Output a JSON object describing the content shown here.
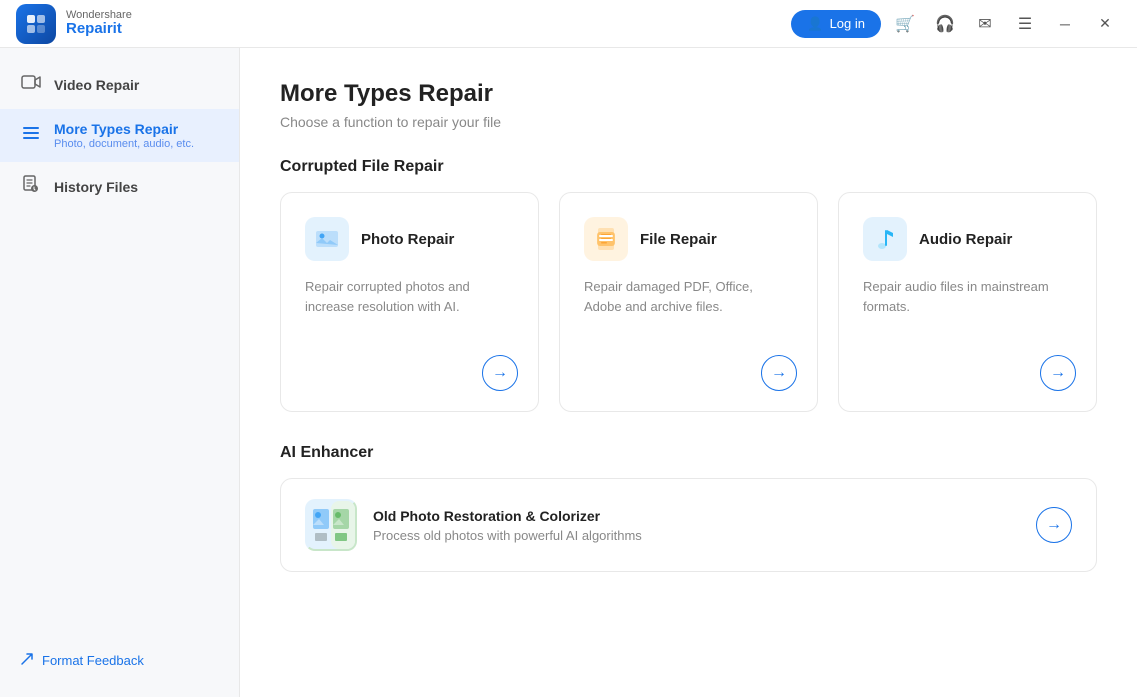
{
  "titlebar": {
    "logo": {
      "brand": "Wondershare",
      "product": "Repairit"
    },
    "login_label": "Log in",
    "icons": {
      "cart": "🛒",
      "headset": "🎧",
      "mail": "✉",
      "menu": "☰",
      "minimize": "─",
      "close": "✕"
    }
  },
  "sidebar": {
    "items": [
      {
        "id": "video-repair",
        "label": "Video Repair",
        "sublabel": "",
        "icon": "🎥",
        "active": false
      },
      {
        "id": "more-types-repair",
        "label": "More Types Repair",
        "sublabel": "Photo, document, audio, etc.",
        "icon": "☰",
        "active": true
      },
      {
        "id": "history-files",
        "label": "History Files",
        "sublabel": "",
        "icon": "☑",
        "active": false
      }
    ],
    "footer": {
      "feedback_label": "Format Feedback",
      "feedback_icon": "↗"
    }
  },
  "main": {
    "page_title": "More Types Repair",
    "page_subtitle": "Choose a function to repair your file",
    "sections": [
      {
        "id": "corrupted-file-repair",
        "title": "Corrupted File Repair",
        "cards": [
          {
            "id": "photo-repair",
            "icon_type": "photo",
            "icon": "🖼",
            "title": "Photo Repair",
            "description": "Repair corrupted photos and increase resolution with AI.",
            "arrow": "→"
          },
          {
            "id": "file-repair",
            "icon_type": "file",
            "icon": "📄",
            "title": "File Repair",
            "description": "Repair damaged PDF, Office, Adobe and archive files.",
            "arrow": "→"
          },
          {
            "id": "audio-repair",
            "icon_type": "audio",
            "icon": "🎵",
            "title": "Audio Repair",
            "description": "Repair audio files in mainstream formats.",
            "arrow": "→"
          }
        ]
      },
      {
        "id": "ai-enhancer",
        "title": "AI Enhancer",
        "cards": [
          {
            "id": "old-photo-restoration",
            "icon": "🖼",
            "title": "Old Photo Restoration & Colorizer",
            "description": "Process old photos with powerful AI algorithms",
            "arrow": "→"
          }
        ]
      }
    ]
  }
}
